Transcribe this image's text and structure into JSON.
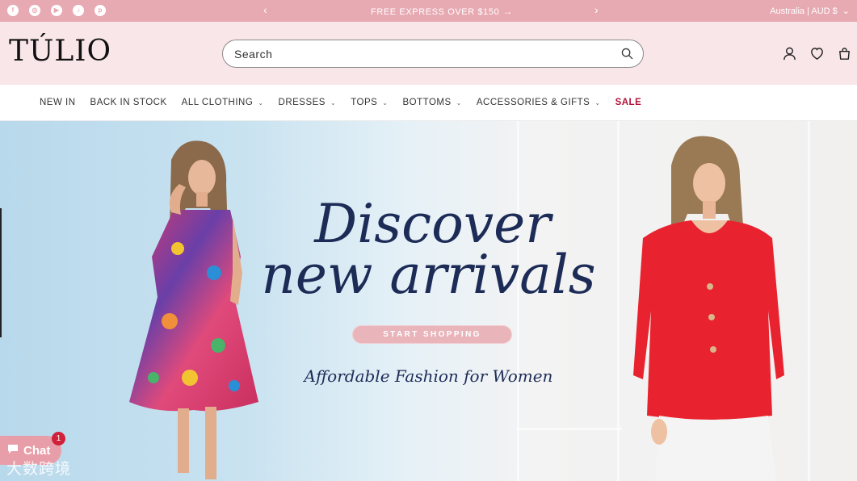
{
  "announcement": {
    "socials": [
      {
        "icon": "facebook-icon",
        "glyph": "f"
      },
      {
        "icon": "instagram-icon",
        "glyph": "◎"
      },
      {
        "icon": "youtube-icon",
        "glyph": "▶"
      },
      {
        "icon": "tiktok-icon",
        "glyph": "♪"
      },
      {
        "icon": "pinterest-icon",
        "glyph": "p"
      }
    ],
    "text": "FREE EXPRESS OVER $150",
    "locale": "Australia | AUD $"
  },
  "header": {
    "logo": "TÚLIO",
    "search_placeholder": "Search"
  },
  "nav": [
    {
      "label": "NEW IN",
      "dropdown": false
    },
    {
      "label": "BACK IN STOCK",
      "dropdown": false
    },
    {
      "label": "ALL CLOTHING",
      "dropdown": true
    },
    {
      "label": "DRESSES",
      "dropdown": true
    },
    {
      "label": "TOPS",
      "dropdown": true
    },
    {
      "label": "BOTTOMS",
      "dropdown": true
    },
    {
      "label": "ACCESSORIES & GIFTS",
      "dropdown": true
    },
    {
      "label": "SALE",
      "dropdown": false,
      "sale": true
    }
  ],
  "hero": {
    "title_line1": "Discover",
    "title_line2": "new arrivals",
    "cta": "START SHOPPING",
    "subtitle": "Affordable Fashion for Women"
  },
  "chat": {
    "label": "Chat",
    "badge": "1"
  },
  "watermark": "大数跨境",
  "colors": {
    "announcement_bg": "#e7a9b2",
    "header_bg": "#f9e6e9",
    "sale": "#b0123a",
    "hero_text": "#1d2c57",
    "cta_bg": "#e9b5bb"
  }
}
